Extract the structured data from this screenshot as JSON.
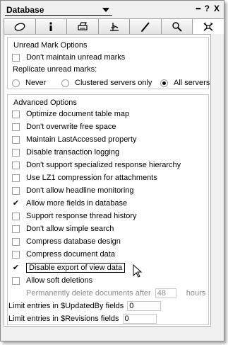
{
  "titlebar": {
    "dropdown_label": "Database",
    "dots_label": "▪▪▪",
    "help_label": "?",
    "close_label": "X"
  },
  "tabs": [
    {
      "icon": "info-ellipse-icon"
    },
    {
      "icon": "info-i-icon"
    },
    {
      "icon": "printer-icon"
    },
    {
      "icon": "design-icon"
    },
    {
      "icon": "pen-icon"
    },
    {
      "icon": "search-icon"
    },
    {
      "icon": "advanced-propeller-icon",
      "active": true
    }
  ],
  "unread": {
    "title": "Unread Mark Options",
    "dont_maintain": {
      "label": "Don't maintain unread marks",
      "checked": false
    },
    "replicate_label": "Replicate unread marks:",
    "radios": [
      {
        "label": "Never",
        "selected": false
      },
      {
        "label": "Clustered servers only",
        "selected": false
      },
      {
        "label": "All servers",
        "selected": true
      }
    ]
  },
  "advanced": {
    "title": "Advanced Options",
    "options": [
      {
        "label": "Optimize document table map",
        "checked": false
      },
      {
        "label": "Don't overwrite free space",
        "checked": false
      },
      {
        "label": "Maintain LastAccessed property",
        "checked": false
      },
      {
        "label": "Disable transaction logging",
        "checked": false
      },
      {
        "label": "Don't support specialized response hierarchy",
        "checked": false
      },
      {
        "label": "Use LZ1 compression for attachments",
        "checked": false
      },
      {
        "label": "Don't allow headline monitoring",
        "checked": false
      },
      {
        "label": "Allow more fields in database",
        "checked": true
      },
      {
        "label": "Support response thread history",
        "checked": false
      },
      {
        "label": "Don't allow simple search",
        "checked": false
      },
      {
        "label": "Compress database design",
        "checked": false
      },
      {
        "label": "Compress document data",
        "checked": false
      },
      {
        "label": "Disable export of view data",
        "checked": true
      },
      {
        "label": "Allow soft deletions",
        "checked": false
      }
    ],
    "perm_delete_label": "Permanently delete documents after",
    "perm_delete_value": "48",
    "perm_delete_unit": "hours",
    "limit_updated_label": "Limit entries in $UpdatedBy fields",
    "limit_updated_value": "0",
    "limit_revisions_label": "Limit entries in $Revisions fields",
    "limit_revisions_value": "0"
  }
}
